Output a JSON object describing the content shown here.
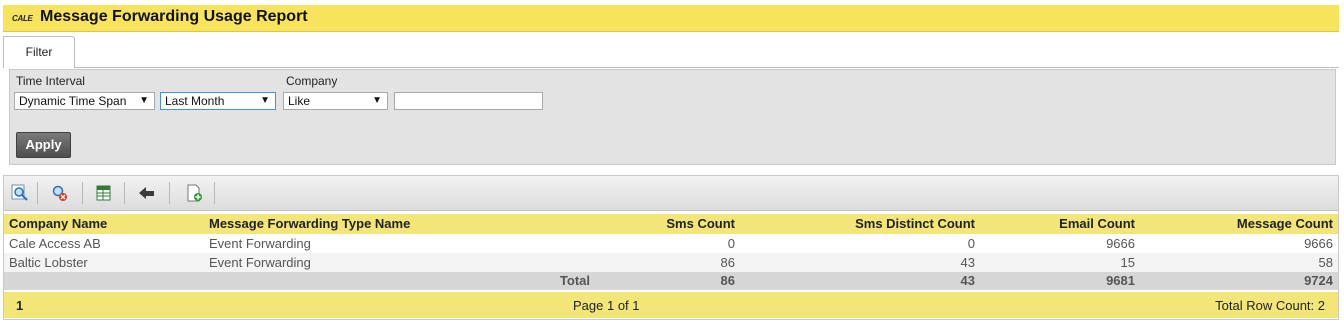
{
  "header": {
    "logo_text": "CALE",
    "title": "Message Forwarding Usage Report"
  },
  "tabs": [
    {
      "label": "Filter"
    }
  ],
  "filter": {
    "time_interval_label": "Time Interval",
    "time_mode": "Dynamic Time Span",
    "time_span": "Last Month",
    "company_label": "Company",
    "company_op": "Like",
    "company_value": "",
    "apply_label": "Apply"
  },
  "toolbar": {
    "icons": [
      "search-icon",
      "clear-search-icon",
      "export-excel-icon",
      "back-arrow-icon",
      "new-report-icon"
    ]
  },
  "table": {
    "columns": [
      "Company Name",
      "Message Forwarding Type Name",
      "Sms Count",
      "Sms Distinct Count",
      "Email Count",
      "Message Count"
    ],
    "rows": [
      [
        "Cale Access AB",
        "Event Forwarding",
        "0",
        "0",
        "9666",
        "9666"
      ],
      [
        "Baltic Lobster",
        "Event Forwarding",
        "86",
        "43",
        "15",
        "58"
      ]
    ],
    "total": {
      "label": "Total",
      "sms": "86",
      "sms_distinct": "43",
      "email": "9681",
      "message": "9724"
    }
  },
  "pager": {
    "page_number": "1",
    "page_text": "Page 1 of 1",
    "row_count_text": "Total Row Count: 2"
  }
}
